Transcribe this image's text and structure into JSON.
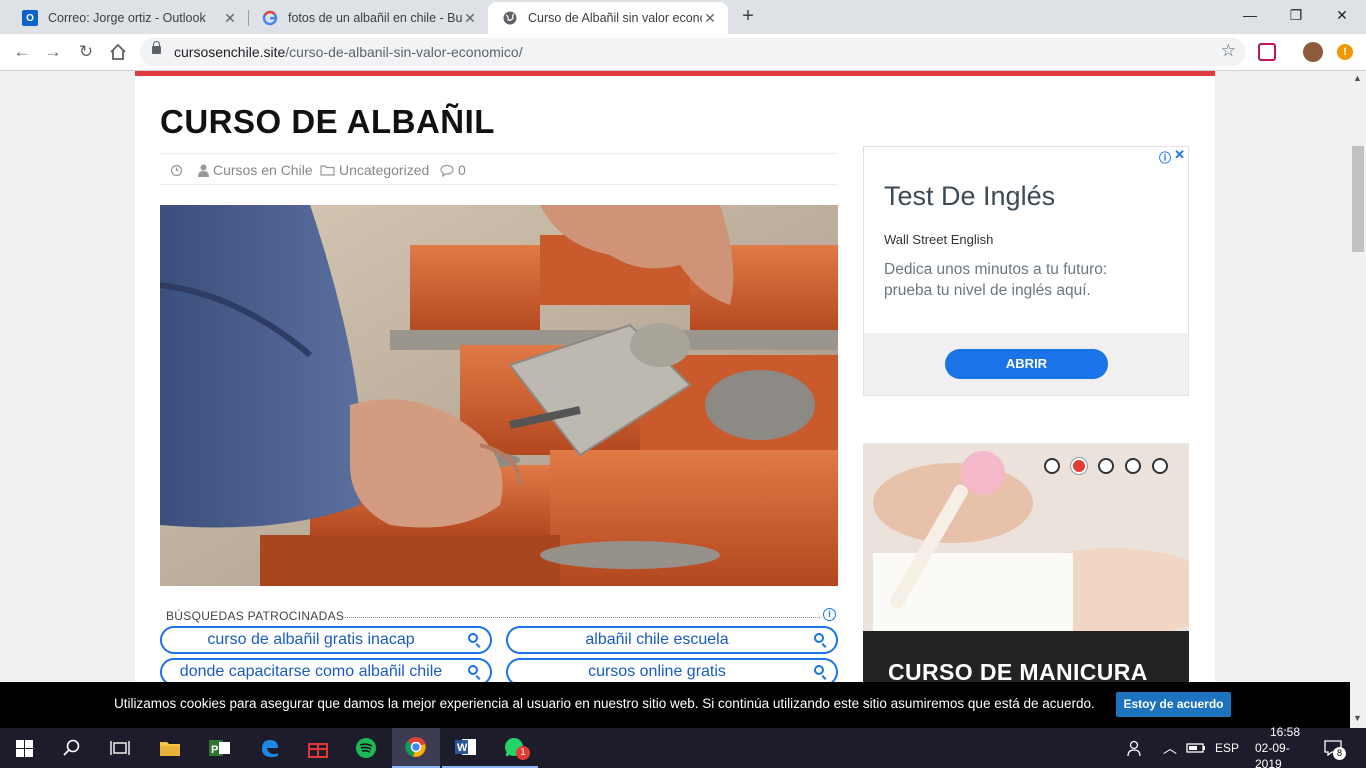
{
  "browser": {
    "tabs": [
      {
        "title": "Correo: Jorge ortiz - Outlook",
        "icon": "outlook-icon"
      },
      {
        "title": "fotos de un albañil en chile - Bus",
        "icon": "google-icon"
      },
      {
        "title": "Curso de Albañil sin valor econo",
        "icon": "globe-icon"
      }
    ],
    "url_domain": "cursosenchile.site",
    "url_path": "/curso-de-albanil-sin-valor-economico/"
  },
  "article": {
    "title": "CURSO DE ALBAÑIL",
    "author": "Cursos en Chile",
    "category": "Uncategorized",
    "comments": "0"
  },
  "sponsored": {
    "label": "BÚSQUEDAS PATROCINADAS",
    "searches": [
      "curso de albañil gratis inacap",
      "albañil chile escuela",
      "donde capacitarse como albañil chile",
      "cursos online gratis"
    ]
  },
  "ad": {
    "headline": "Test De Inglés",
    "brand": "Wall Street English",
    "description": "Dedica unos minutos a tu futuro: prueba tu nivel de inglés aquí.",
    "button": "ABRIR"
  },
  "slider": {
    "title": "CURSO DE MANICURA",
    "dots": 5,
    "active_dot": 2
  },
  "cookie": {
    "text": "Utilizamos cookies para asegurar que damos la mejor experiencia al usuario en nuestro sitio web. Si continúa utilizando este sitio asumiremos que está de acuerdo.",
    "button": "Estoy de acuerdo"
  },
  "taskbar": {
    "language": "ESP",
    "time": "16:58",
    "date": "02-09-2019",
    "notifications": "8",
    "whatsapp_badge": "1"
  },
  "colors": {
    "accent_red": "#e03a3e",
    "link_blue": "#1a73e8",
    "cookie_button": "#1e73be"
  }
}
